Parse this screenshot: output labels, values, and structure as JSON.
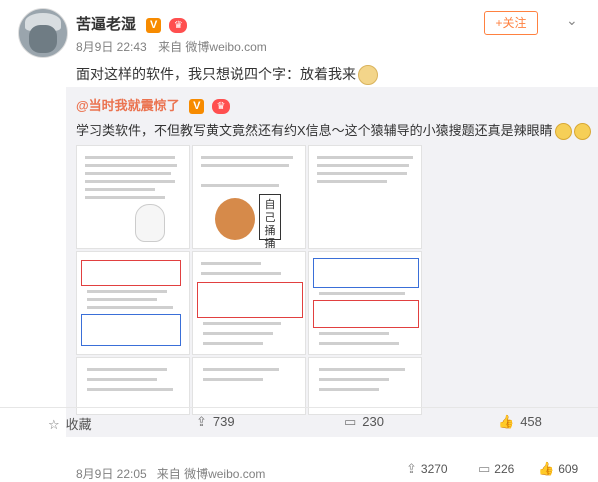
{
  "post": {
    "author": "苦逼老湿",
    "badge_v": "V",
    "time": "8月9日 22:43",
    "source": "来自 微博weibo.com",
    "follow_label": "+关注",
    "text": "面对这样的软件，我只想说四个字：放着我来",
    "emoji": "doge"
  },
  "repost": {
    "author": "@当时我就震惊了",
    "badge_v": "V",
    "text": "学习类软件，不但教写黄文竟然还有约X信息～这个猿辅导的小猿搜题还真是辣眼睛",
    "emoji": "clap",
    "time": "8月9日 22:05",
    "source": "来自 微博weibo.com",
    "actions": {
      "repost": "3270",
      "comment": "226",
      "like": "609"
    },
    "thumb_sign": "自己捅捅"
  },
  "footer": {
    "collect": "收藏",
    "repost": "739",
    "comment": "230",
    "like": "458"
  },
  "icons": [
    "v-badge-icon",
    "member-icon",
    "chevron-down-icon",
    "repost-icon",
    "comment-icon",
    "like-icon",
    "collect-icon"
  ]
}
